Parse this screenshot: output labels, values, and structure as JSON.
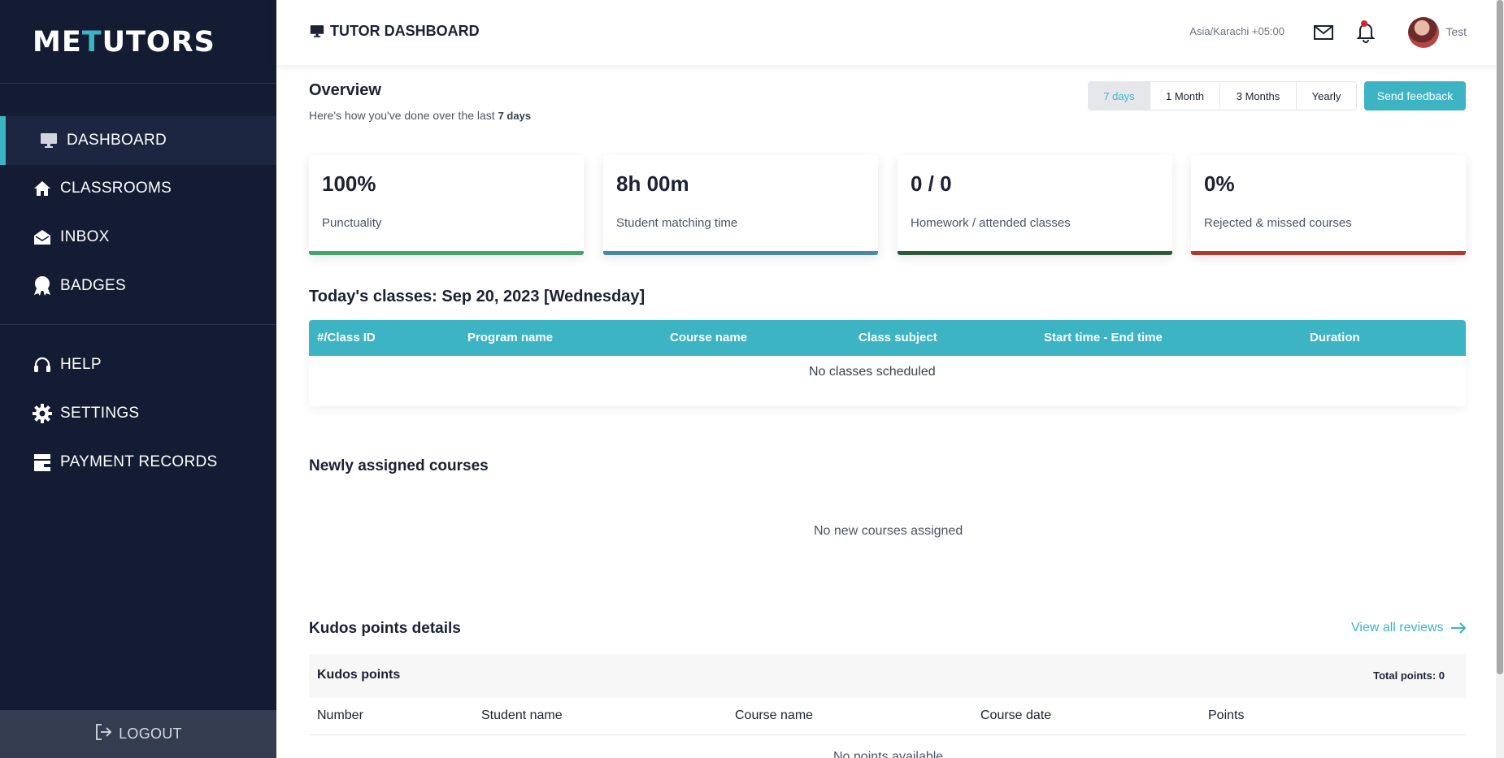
{
  "logo": {
    "part1": "ME",
    "part2": "T",
    "part3": "UTORS"
  },
  "sidebar": {
    "items": [
      {
        "label": "DASHBOARD",
        "icon": "monitor-icon"
      },
      {
        "label": "CLASSROOMS",
        "icon": "home-icon"
      },
      {
        "label": "INBOX",
        "icon": "envelope-open-icon"
      },
      {
        "label": "BADGES",
        "icon": "badge-icon"
      },
      {
        "label": "HELP",
        "icon": "headset-icon"
      },
      {
        "label": "SETTINGS",
        "icon": "gear-icon"
      },
      {
        "label": "PAYMENT RECORDS",
        "icon": "wallet-icon"
      }
    ],
    "logout": "LOGOUT"
  },
  "header": {
    "title": "TUTOR DASHBOARD",
    "timezone": "Asia/Karachi +05:00",
    "user": "Test"
  },
  "overview": {
    "title": "Overview",
    "subtitle": "Here's how you've done over the last",
    "subtitle_period": "7 days",
    "periods": [
      "7 days",
      "1 Month",
      "3 Months",
      "Yearly"
    ],
    "active_period": "7 days",
    "feedback": "Send feedback"
  },
  "stats": [
    {
      "value": "100%",
      "label": "Punctuality",
      "color": "#43a56a"
    },
    {
      "value": "8h 00m",
      "label": "Student matching time",
      "color": "#4a88aa"
    },
    {
      "value": "0 / 0",
      "label": "Homework / attended classes",
      "color": "#2c5a3a"
    },
    {
      "value": "0%",
      "label": "Rejected & missed courses",
      "color": "#b23a2a"
    }
  ],
  "today": {
    "title": "Today's classes: Sep 20, 2023 [Wednesday]",
    "columns": [
      "#/Class ID",
      "Program name",
      "Course name",
      "Class subject",
      "Start time - End time",
      "Duration"
    ],
    "empty": "No classes scheduled"
  },
  "new_courses": {
    "title": "Newly assigned courses",
    "empty": "No new courses assigned"
  },
  "kudos": {
    "title": "Kudos points details",
    "view_all": "View all reviews",
    "table_title": "Kudos points",
    "total": "Total points: 0",
    "columns": [
      "Number",
      "Student name",
      "Course name",
      "Course date",
      "Points"
    ],
    "empty": "No points available"
  },
  "colors": {
    "accent": "#3db4c4",
    "sidebar": "#141c33"
  }
}
